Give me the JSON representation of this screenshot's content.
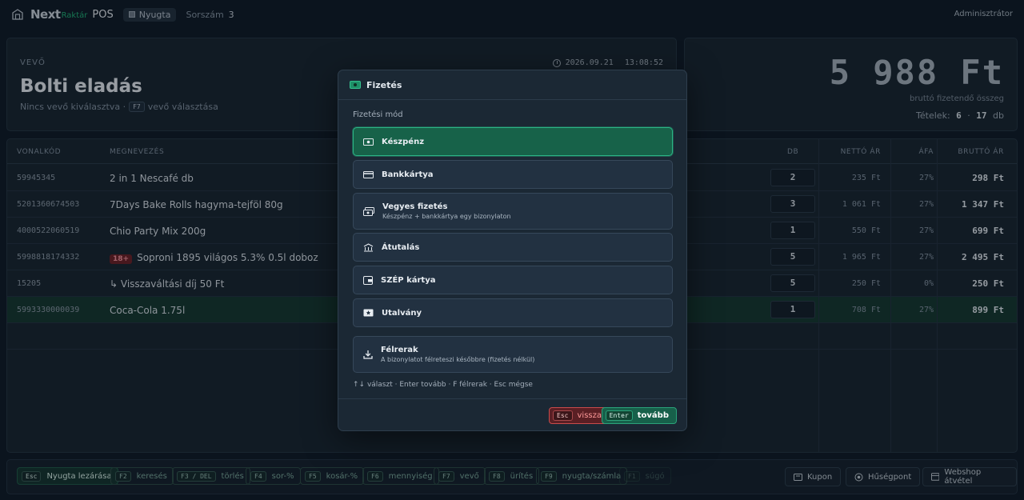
{
  "topbar": {
    "brand_main": "Next",
    "brand_sub": "Raktár",
    "brand_pos": "POS",
    "doc_type": "Nyugta",
    "serial_label": "Sorszám",
    "serial_value": "3",
    "user": "Adminisztrátor"
  },
  "customer": {
    "label": "VEVŐ",
    "name": "Bolti eladás",
    "none_selected": "Nincs vevő kiválasztva ·",
    "select_key": "F7",
    "select_label": "vevő választása",
    "date": "2026.09.21",
    "time": "13:08:52"
  },
  "totals": {
    "amount": "5 988 Ft",
    "subtitle": "bruttó fizetendő összeg",
    "items_label": "Tételek:",
    "items_count": "6",
    "items_sep": "·",
    "items_qty": "17",
    "items_unit": "db"
  },
  "table": {
    "headers": {
      "code": "VONALKÓD",
      "name": "MEGNEVEZÉS",
      "qty": "DB",
      "net": "NETTÓ ÁR",
      "vat": "ÁFA",
      "gross": "BRUTTÓ ÁR"
    },
    "rows": [
      {
        "code": "59945345",
        "name": "2 in 1 Nescafé db",
        "qty": "2",
        "net": "235 Ft",
        "vat": "27%",
        "gross": "298 Ft"
      },
      {
        "code": "5201360674503",
        "name": "7Days Bake Rolls hagyma-tejföl 80g",
        "qty": "3",
        "net": "1 061 Ft",
        "vat": "27%",
        "gross": "1 347 Ft"
      },
      {
        "code": "4000522060519",
        "name": "Chio Party Mix 200g",
        "qty": "1",
        "net": "550 Ft",
        "vat": "27%",
        "gross": "699 Ft"
      },
      {
        "code": "5998818174332",
        "age": "18+",
        "name": "Soproni 1895 világos 5.3% 0.5l doboz",
        "qty": "5",
        "net": "1 965 Ft",
        "vat": "27%",
        "gross": "2 495 Ft"
      },
      {
        "code": "15205",
        "name": "↳ Visszaváltási díj 50 Ft",
        "qty": "5",
        "net": "250 Ft",
        "vat": "0%",
        "gross": "250 Ft"
      },
      {
        "code": "5993330000039",
        "name": "Coca-Cola 1.75l",
        "qty": "1",
        "net": "708 Ft",
        "vat": "27%",
        "gross": "899 Ft"
      }
    ]
  },
  "bottombar": {
    "keys": [
      {
        "key": "Esc",
        "label": "Nyugta lezárása"
      },
      {
        "key": "F2",
        "label": "keresés"
      },
      {
        "key": "F3 / DEL",
        "label": "törlés"
      },
      {
        "key": "F4",
        "label": "sor-%"
      },
      {
        "key": "F5",
        "label": "kosár-%"
      },
      {
        "key": "F6",
        "label": "mennyiség"
      },
      {
        "key": "F7",
        "label": "vevő"
      },
      {
        "key": "F8",
        "label": "ürítés"
      },
      {
        "key": "F9",
        "label": "nyugta/számla"
      },
      {
        "key": "F1",
        "label": "súgó"
      }
    ],
    "coupon": "Kupon",
    "loyalty": "Hűségpont",
    "webshop": "Webshop átvétel"
  },
  "modal": {
    "title": "Fizetés",
    "section": "Fizetési mód",
    "options": [
      {
        "label": "Készpénz",
        "icon": "cash-icon"
      },
      {
        "label": "Bankkártya",
        "icon": "card-icon"
      },
      {
        "label": "Vegyes fizetés",
        "desc": "Készpénz + bankkártya egy bizonylaton",
        "icon": "mixed-payment-icon"
      },
      {
        "label": "Átutalás",
        "icon": "bank-icon"
      },
      {
        "label": "SZÉP kártya",
        "icon": "wallet-icon"
      },
      {
        "label": "Utalvány",
        "icon": "voucher-icon"
      },
      {
        "label": "Félrerak",
        "desc": "A bizonylatot félreteszi későbbre (fizetés nélkül)",
        "icon": "download-icon"
      }
    ],
    "hint": "↑↓ választ · Enter tovább · F félrerak · Esc mégse",
    "back_key": "Esc",
    "back_label": "vissza",
    "next_key": "Enter",
    "next_label": "tovább"
  },
  "colors": {
    "accent": "#1f9d72",
    "danger": "#c84b4b",
    "background": "#0f1a26"
  }
}
